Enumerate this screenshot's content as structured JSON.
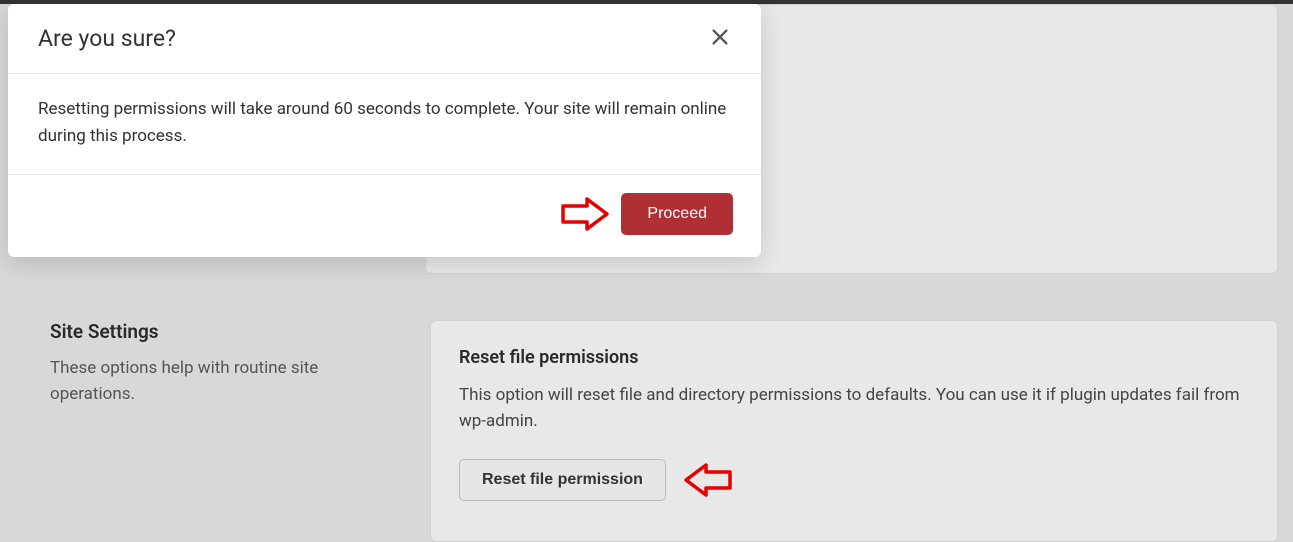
{
  "modal": {
    "title": "Are you sure?",
    "body": "Resetting permissions will take around 60 seconds to complete. Your site will remain online during this process.",
    "proceed_label": "Proceed"
  },
  "settings": {
    "title": "Site Settings",
    "description": "These options help with routine site operations."
  },
  "card": {
    "title": "Reset file permissions",
    "description": "This option will reset file and directory permissions to defaults. You can use it if plugin updates fail from wp-admin.",
    "button_label": "Reset file permission"
  }
}
